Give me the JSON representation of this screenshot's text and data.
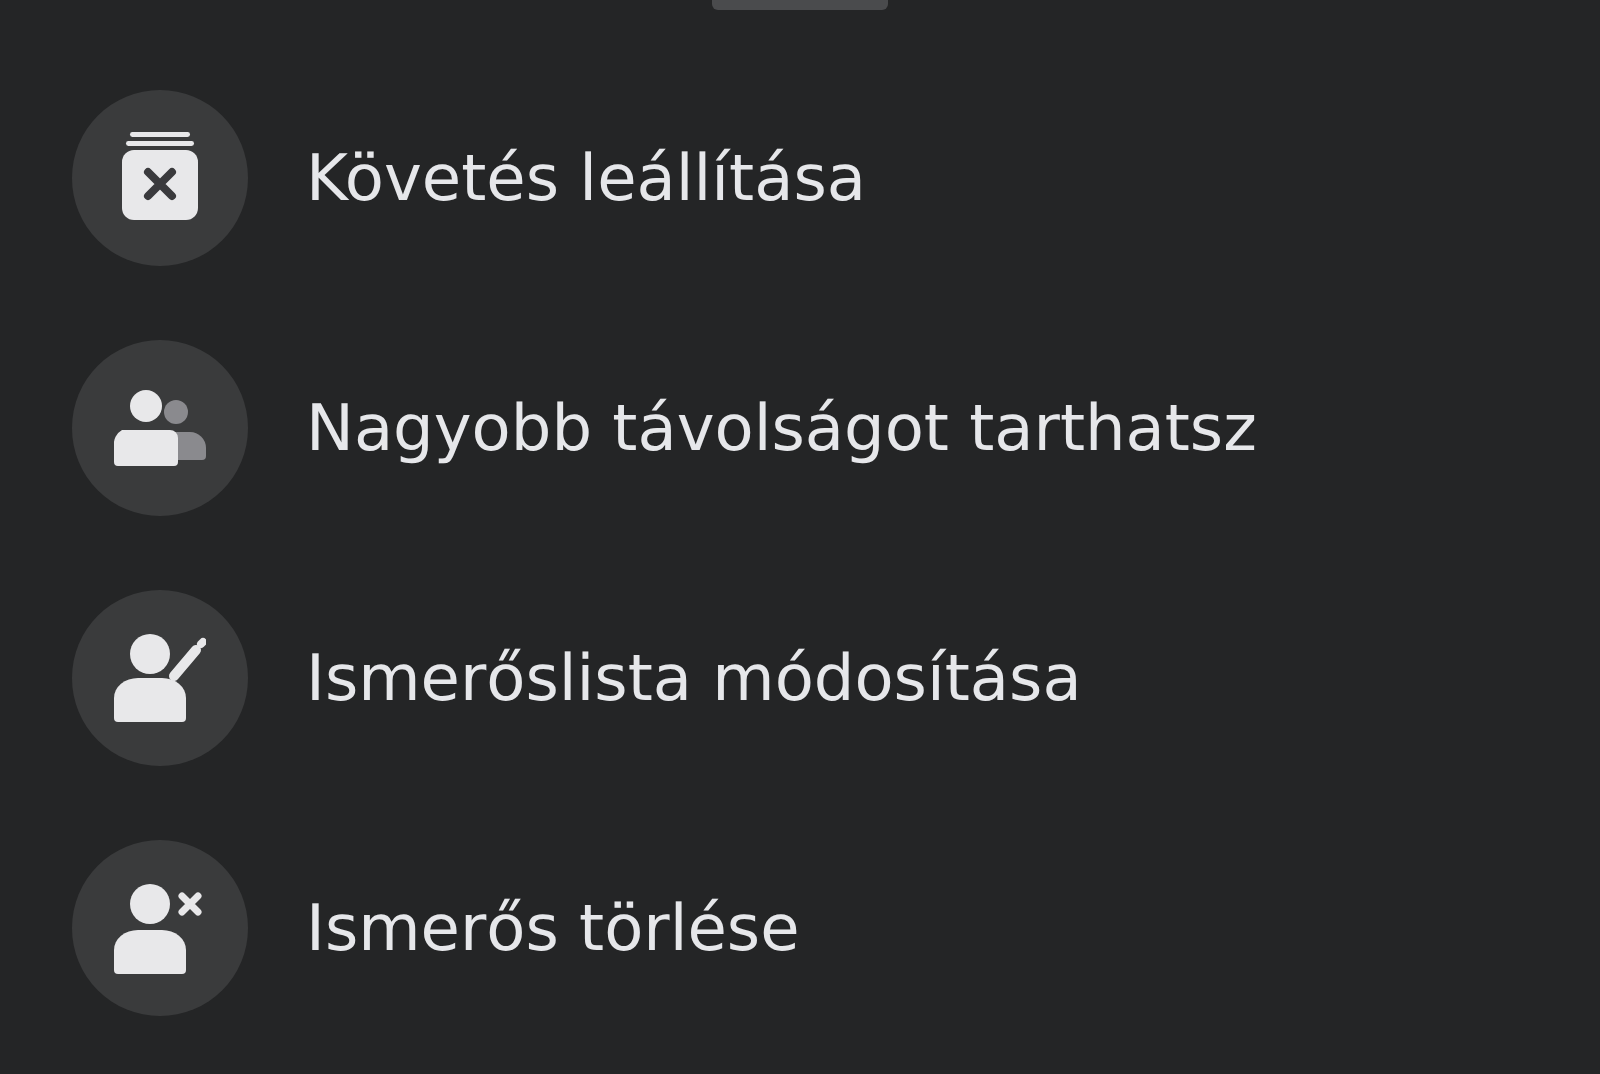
{
  "items": [
    {
      "kind": "archive-x",
      "label": "Követés leállítása"
    },
    {
      "kind": "people",
      "label": "Nagyobb távolságot tarthatsz"
    },
    {
      "kind": "person-pencil",
      "label": "Ismerőslista módosítása"
    },
    {
      "kind": "person-x",
      "label": "Ismerős törlése"
    }
  ]
}
